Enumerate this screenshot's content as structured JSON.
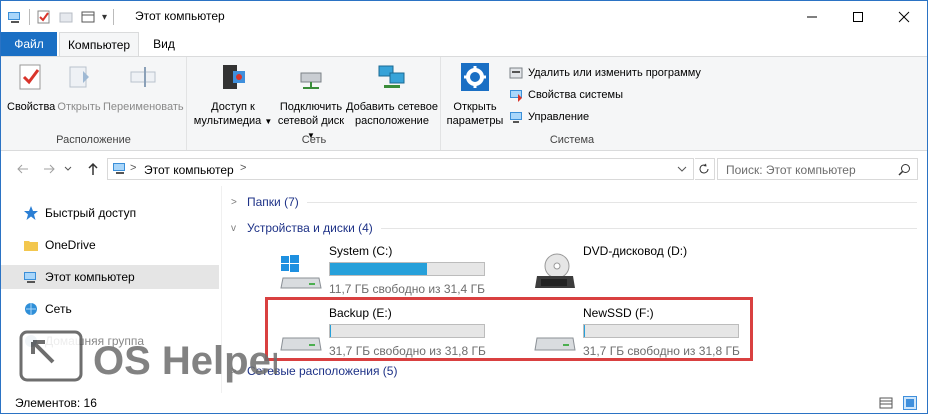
{
  "window": {
    "title": "Этот компьютер",
    "qat_dropdown": "▾"
  },
  "tabs": {
    "file": "Файл",
    "computer": "Компьютер",
    "view": "Вид"
  },
  "ribbon": {
    "location": {
      "label": "Расположение",
      "properties": "Свойства",
      "open": "Открыть",
      "rename": "Переименовать"
    },
    "network": {
      "label": "Сеть",
      "media_access_1": "Доступ к",
      "media_access_2": "мультимедиа",
      "map_drive_1": "Подключить",
      "map_drive_2": "сетевой диск",
      "add_location_1": "Добавить сетевое",
      "add_location_2": "расположение"
    },
    "system": {
      "label": "Система",
      "open_settings_1": "Открыть",
      "open_settings_2": "параметры",
      "uninstall": "Удалить или изменить программу",
      "system_properties": "Свойства системы",
      "manage": "Управление"
    }
  },
  "address": {
    "path": "Этот компьютер",
    "separator": ">",
    "search_placeholder": "Поиск: Этот компьютер"
  },
  "navpane": {
    "items": [
      {
        "label": "Быстрый доступ",
        "icon": "star-icon"
      },
      {
        "label": "OneDrive",
        "icon": "folder-icon"
      },
      {
        "label": "Этот компьютер",
        "icon": "computer-icon"
      },
      {
        "label": "Сеть",
        "icon": "network-icon"
      },
      {
        "label": "Домашняя группа",
        "icon": "homegroup-icon"
      }
    ]
  },
  "content": {
    "folders_header": "Папки (7)",
    "devices_header": "Устройства и диски (4)",
    "network_header": "Сетевые расположения (5)",
    "drives": [
      {
        "name": "System (C:)",
        "free": "11,7 ГБ свободно из 31,4 ГБ",
        "used_fraction": 0.63
      },
      {
        "name": "DVD-дисковод (D:)"
      },
      {
        "name": "Backup (E:)",
        "free": "31,7 ГБ свободно из 31,8 ГБ",
        "used_fraction": 0.003
      },
      {
        "name": "NewSSD (F:)",
        "free": "31,7 ГБ свободно из 31,8 ГБ",
        "used_fraction": 0.003
      }
    ]
  },
  "status": {
    "items": "Элементов: 16"
  },
  "watermark": {
    "text": "OS Helper"
  },
  "colors": {
    "accent": "#1a6fc4",
    "bar_fill": "#26a0da",
    "highlight": "#d94040"
  }
}
